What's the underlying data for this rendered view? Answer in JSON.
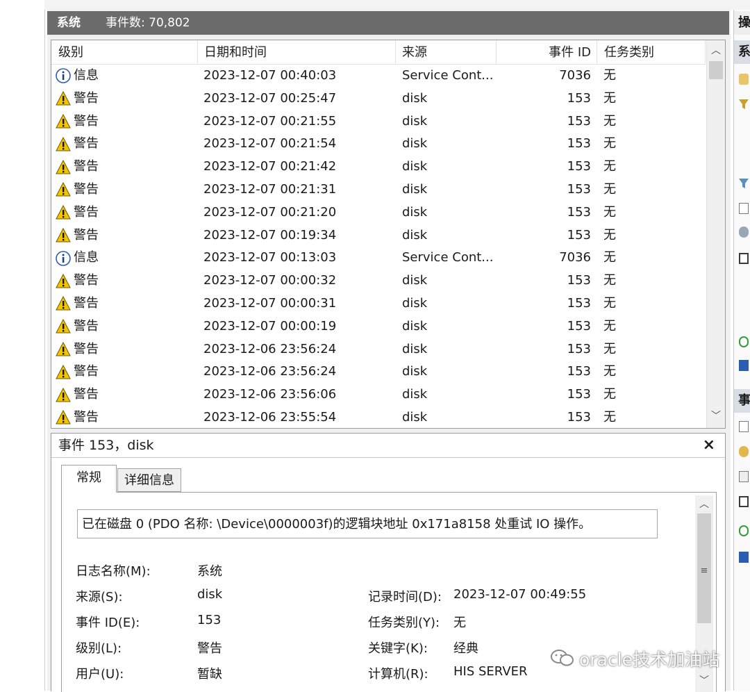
{
  "header": {
    "log_name": "系统",
    "event_count": "事件数: 70,802"
  },
  "columns": {
    "level": "级别",
    "datetime": "日期和时间",
    "source": "来源",
    "event_id": "事件 ID",
    "task": "任务类别"
  },
  "rows": [
    {
      "level": "信息",
      "type": "info",
      "datetime": "2023-12-07 00:40:03",
      "source": "Service Cont...",
      "event_id": "7036",
      "task": "无"
    },
    {
      "level": "警告",
      "type": "warn",
      "datetime": "2023-12-07 00:25:47",
      "source": "disk",
      "event_id": "153",
      "task": "无"
    },
    {
      "level": "警告",
      "type": "warn",
      "datetime": "2023-12-07 00:21:55",
      "source": "disk",
      "event_id": "153",
      "task": "无"
    },
    {
      "level": "警告",
      "type": "warn",
      "datetime": "2023-12-07 00:21:54",
      "source": "disk",
      "event_id": "153",
      "task": "无"
    },
    {
      "level": "警告",
      "type": "warn",
      "datetime": "2023-12-07 00:21:42",
      "source": "disk",
      "event_id": "153",
      "task": "无"
    },
    {
      "level": "警告",
      "type": "warn",
      "datetime": "2023-12-07 00:21:31",
      "source": "disk",
      "event_id": "153",
      "task": "无"
    },
    {
      "level": "警告",
      "type": "warn",
      "datetime": "2023-12-07 00:21:20",
      "source": "disk",
      "event_id": "153",
      "task": "无"
    },
    {
      "level": "警告",
      "type": "warn",
      "datetime": "2023-12-07 00:19:34",
      "source": "disk",
      "event_id": "153",
      "task": "无"
    },
    {
      "level": "信息",
      "type": "info",
      "datetime": "2023-12-07 00:13:03",
      "source": "Service Cont...",
      "event_id": "7036",
      "task": "无"
    },
    {
      "level": "警告",
      "type": "warn",
      "datetime": "2023-12-07 00:00:32",
      "source": "disk",
      "event_id": "153",
      "task": "无"
    },
    {
      "level": "警告",
      "type": "warn",
      "datetime": "2023-12-07 00:00:31",
      "source": "disk",
      "event_id": "153",
      "task": "无"
    },
    {
      "level": "警告",
      "type": "warn",
      "datetime": "2023-12-07 00:00:19",
      "source": "disk",
      "event_id": "153",
      "task": "无"
    },
    {
      "level": "警告",
      "type": "warn",
      "datetime": "2023-12-06 23:56:24",
      "source": "disk",
      "event_id": "153",
      "task": "无"
    },
    {
      "level": "警告",
      "type": "warn",
      "datetime": "2023-12-06 23:56:24",
      "source": "disk",
      "event_id": "153",
      "task": "无"
    },
    {
      "level": "警告",
      "type": "warn",
      "datetime": "2023-12-06 23:56:06",
      "source": "disk",
      "event_id": "153",
      "task": "无"
    },
    {
      "level": "警告",
      "type": "warn",
      "datetime": "2023-12-06 23:55:54",
      "source": "disk",
      "event_id": "153",
      "task": "无"
    }
  ],
  "detail": {
    "title": "事件 153，disk",
    "close": "×",
    "tabs": {
      "general": "常规",
      "details": "详细信息"
    },
    "message": "已在磁盘 0 (PDO 名称: \\Device\\0000003f)的逻辑块地址 0x171a8158 处重试 IO 操作。",
    "labels": {
      "log_name": "日志名称(M):",
      "source": "来源(S):",
      "event_id": "事件 ID(E):",
      "level": "级别(L):",
      "user": "用户(U):",
      "logged": "记录时间(D):",
      "task": "任务类别(Y):",
      "keywords": "关键字(K):",
      "computer": "计算机(R):"
    },
    "values": {
      "log_name": "系统",
      "source": "disk",
      "event_id": "153",
      "level": "警告",
      "user": "暂缺",
      "logged": "2023-12-07 00:49:55",
      "task": "无",
      "keywords": "经典",
      "computer": "HIS SERVER"
    }
  },
  "right_panel": {
    "actions_header": "操",
    "section1": "系",
    "section2": "事"
  },
  "watermark": "oracle技术加油站",
  "colors": {
    "titlebar": "#6c6c6c",
    "warning": "#f5c400",
    "info": "#2a5db0"
  }
}
